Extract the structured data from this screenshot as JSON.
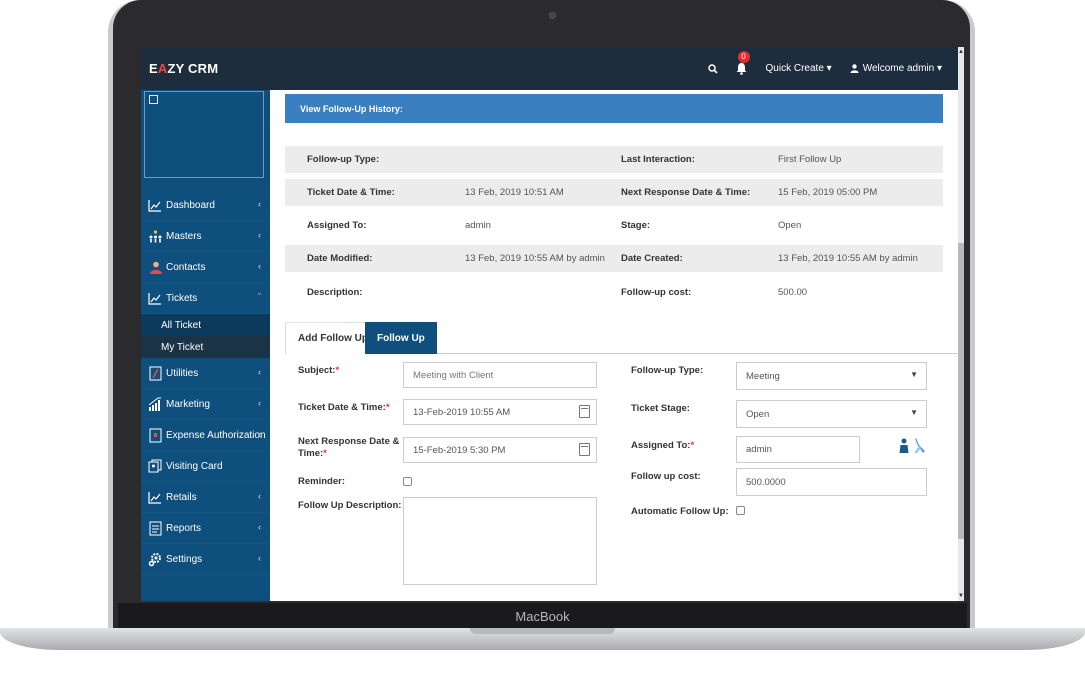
{
  "laptop": {
    "brand_label": "MacBook"
  },
  "topnav": {
    "logo_pre": "E",
    "logo_accent": "A",
    "logo_post": "ZY CRM",
    "notification_count": "0",
    "quick_create": "Quick Create ▾",
    "welcome": "Welcome admin ▾",
    "search_icon": "search-icon",
    "bell_icon": "bell-icon"
  },
  "sidebar": {
    "items": [
      {
        "label": "Dashboard",
        "icon": "line-chart-icon"
      },
      {
        "label": "Masters",
        "icon": "users-hierarchy-icon"
      },
      {
        "label": "Contacts",
        "icon": "contacts-icon"
      },
      {
        "label": "Tickets",
        "icon": "line-chart-icon"
      },
      {
        "label": "Utilities",
        "icon": "pencil-icon"
      },
      {
        "label": "Marketing",
        "icon": "marketing-icon"
      },
      {
        "label": "Expense Authorization",
        "icon": "expense-icon"
      },
      {
        "label": "Visiting Card",
        "icon": "card-icon"
      },
      {
        "label": "Retails",
        "icon": "line-chart-icon"
      },
      {
        "label": "Reports",
        "icon": "report-icon"
      },
      {
        "label": "Settings",
        "icon": "gear-icon"
      }
    ],
    "tickets_sub": [
      {
        "label": "All Ticket"
      },
      {
        "label": "My Ticket"
      }
    ]
  },
  "history": {
    "label": "View Follow-Up History:"
  },
  "info": {
    "rows": [
      {
        "l1": "Follow-up Type:",
        "v1": "",
        "l2": "Last Interaction:",
        "v2": "First Follow Up"
      },
      {
        "l1": "Ticket Date & Time:",
        "v1": "13 Feb, 2019 10:51 AM",
        "l2": "Next Response Date & Time:",
        "v2": "15 Feb, 2019 05:00 PM"
      },
      {
        "l1": "Assigned To:",
        "v1": "admin",
        "l2": "Stage:",
        "v2": "Open"
      },
      {
        "l1": "Date Modified:",
        "v1": "13 Feb, 2019 10:55 AM by admin",
        "l2": "Date Created:",
        "v2": "13 Feb, 2019 10:55 AM by admin"
      },
      {
        "l1": "Description:",
        "v1": "",
        "l2": "Follow-up cost:",
        "v2": "500.00"
      }
    ]
  },
  "tabs": {
    "add": "Add Follow Up",
    "follow": "Follow Up"
  },
  "form": {
    "subject_label": "Subject:",
    "subject_value": "Meeting with Client",
    "ticket_dt_label": "Ticket Date & Time:",
    "ticket_dt_value": "13-Feb-2019 10:55 AM",
    "next_resp_label_1": "Next Response Date &",
    "next_resp_label_2": "Time:",
    "next_resp_value": "15-Feb-2019 5:30 PM",
    "reminder_label": "Reminder:",
    "desc_label": "Follow Up Description:",
    "followup_type_label": "Follow-up Type:",
    "followup_type_value": "Meeting",
    "stage_label": "Ticket Stage:",
    "stage_value": "Open",
    "assigned_label": "Assigned To:",
    "assigned_value": "admin",
    "cost_label": "Follow up cost:",
    "cost_value": "500.0000",
    "auto_label": "Automatic Follow Up:",
    "required_mark": "*"
  },
  "colors": {
    "nav_bg": "#1e2d3d",
    "sidebar_bg": "#0f4f7d",
    "accent_blue": "#3a7fbf",
    "logo_accent": "#e74c3c",
    "badge_red": "#e52b2b"
  }
}
